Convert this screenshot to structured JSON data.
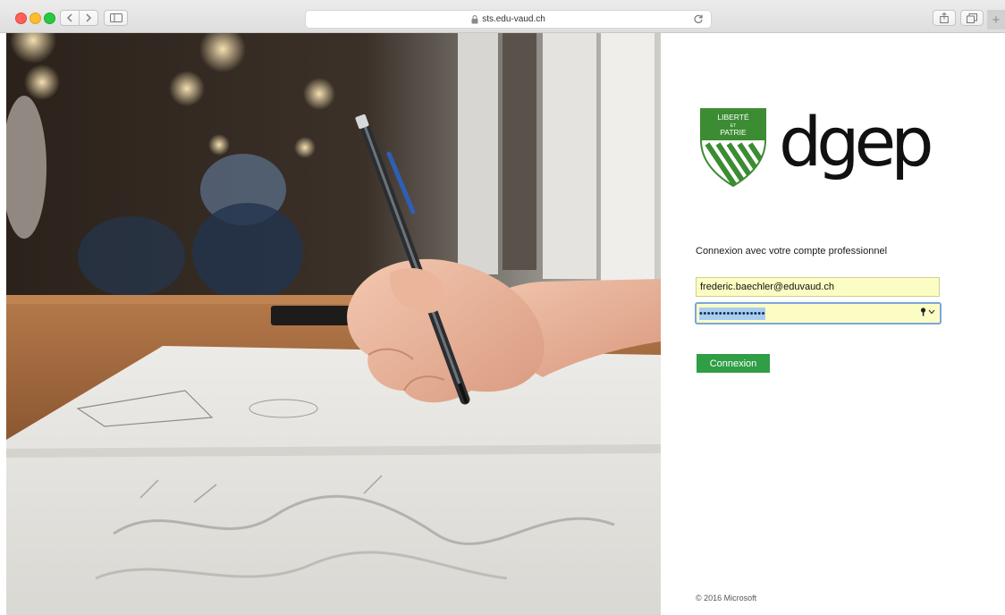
{
  "browser": {
    "url": "sts.edu-vaud.ch",
    "icons": {
      "back": "chevron-left-icon",
      "forward": "chevron-right-icon",
      "sidebar": "sidebar-icon",
      "lock": "lock-icon",
      "reload": "reload-icon",
      "share": "share-icon",
      "tabs": "tabs-icon",
      "new_tab": "plus-icon"
    },
    "new_tab_label": "+"
  },
  "brand": {
    "crest_lines": [
      "LIBERTÉ",
      "ET",
      "PATRIE"
    ],
    "logo_text": "dgep",
    "crest_color": "#3c8c33"
  },
  "login": {
    "title": "Connexion avec votre compte professionnel",
    "email_value": "frederic.baechler@eduvaud.ch",
    "password_mask": "•••••••••••••••••",
    "submit_label": "Connexion",
    "submit_color": "#2f9e44"
  },
  "footer": {
    "copyright": "© 2016 Microsoft"
  }
}
